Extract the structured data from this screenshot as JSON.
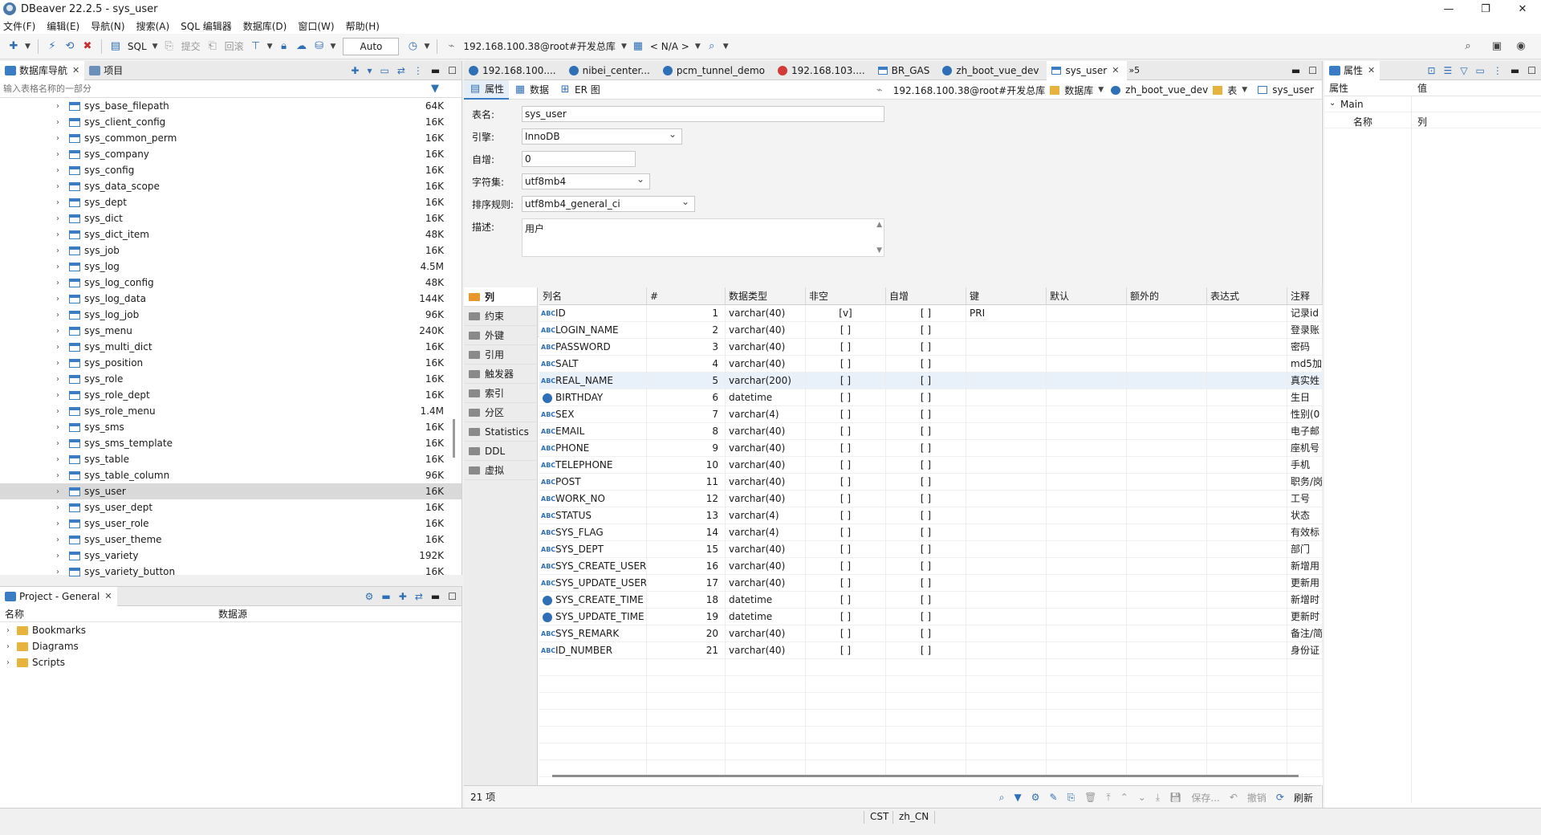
{
  "window": {
    "title": "DBeaver 22.2.5 - sys_user",
    "controls": [
      "—",
      "❐",
      "✕"
    ]
  },
  "menu": [
    "文件(F)",
    "编辑(E)",
    "导航(N)",
    "搜索(A)",
    "SQL 编辑器",
    "数据库(D)",
    "窗口(W)",
    "帮助(H)"
  ],
  "toolbar": {
    "sql_label": "SQL",
    "commit_label": "提交",
    "rollback_label": "回滚",
    "auto_label": "Auto",
    "connection": "192.168.100.38@root#开发总库",
    "schema": "N/A"
  },
  "navigator": {
    "tab_label": "数据库导航",
    "projects_tab_label": "项目",
    "filter_placeholder": "输入表格名称的一部分",
    "tables": [
      {
        "name": "sys_base_filepath",
        "size": "64K"
      },
      {
        "name": "sys_client_config",
        "size": "16K"
      },
      {
        "name": "sys_common_perm",
        "size": "16K"
      },
      {
        "name": "sys_company",
        "size": "16K"
      },
      {
        "name": "sys_config",
        "size": "16K"
      },
      {
        "name": "sys_data_scope",
        "size": "16K"
      },
      {
        "name": "sys_dept",
        "size": "16K"
      },
      {
        "name": "sys_dict",
        "size": "16K"
      },
      {
        "name": "sys_dict_item",
        "size": "48K"
      },
      {
        "name": "sys_job",
        "size": "16K"
      },
      {
        "name": "sys_log",
        "size": "4.5M"
      },
      {
        "name": "sys_log_config",
        "size": "48K"
      },
      {
        "name": "sys_log_data",
        "size": "144K"
      },
      {
        "name": "sys_log_job",
        "size": "96K"
      },
      {
        "name": "sys_menu",
        "size": "240K"
      },
      {
        "name": "sys_multi_dict",
        "size": "16K"
      },
      {
        "name": "sys_position",
        "size": "16K"
      },
      {
        "name": "sys_role",
        "size": "16K"
      },
      {
        "name": "sys_role_dept",
        "size": "16K"
      },
      {
        "name": "sys_role_menu",
        "size": "1.4M"
      },
      {
        "name": "sys_sms",
        "size": "16K"
      },
      {
        "name": "sys_sms_template",
        "size": "16K"
      },
      {
        "name": "sys_table",
        "size": "16K"
      },
      {
        "name": "sys_table_column",
        "size": "96K"
      },
      {
        "name": "sys_user",
        "size": "16K",
        "selected": true
      },
      {
        "name": "sys_user_dept",
        "size": "16K"
      },
      {
        "name": "sys_user_role",
        "size": "16K"
      },
      {
        "name": "sys_user_theme",
        "size": "16K"
      },
      {
        "name": "sys_variety",
        "size": "192K"
      },
      {
        "name": "sys_variety_button",
        "size": "16K"
      }
    ]
  },
  "project": {
    "tab_label": "Project - General",
    "col_name": "名称",
    "col_datasource": "数据源",
    "items": [
      "Bookmarks",
      "Diagrams",
      "Scripts"
    ]
  },
  "editor": {
    "tabs": [
      {
        "label": "192.168.100....",
        "icon": "db"
      },
      {
        "label": "nibei_center...",
        "icon": "db"
      },
      {
        "label": "pcm_tunnel_demo",
        "icon": "db"
      },
      {
        "label": "192.168.103....",
        "icon": "db-red"
      },
      {
        "label": "BR_GAS",
        "icon": "table"
      },
      {
        "label": "zh_boot_vue_dev",
        "icon": "db"
      },
      {
        "label": "sys_user",
        "icon": "table",
        "active": true
      }
    ],
    "overflow_label": "»5",
    "subtabs": [
      "属性",
      "数据",
      "ER 图"
    ],
    "crumbs": {
      "connection": "192.168.100.38@root#开发总库",
      "db_label": "数据库",
      "database": "zh_boot_vue_dev",
      "table_label": "表",
      "table": "sys_user"
    },
    "form": {
      "table_name_label": "表名:",
      "table_name": "sys_user",
      "engine_label": "引擎:",
      "engine": "InnoDB",
      "auto_inc_label": "自增:",
      "auto_inc": "0",
      "charset_label": "字符集:",
      "charset": "utf8mb4",
      "collation_label": "排序规则:",
      "collation": "utf8mb4_general_ci",
      "desc_label": "描述:",
      "desc": "用户"
    },
    "side_tabs": [
      "列",
      "约束",
      "外键",
      "引用",
      "触发器",
      "索引",
      "分区",
      "Statistics",
      "DDL",
      "虚拟"
    ],
    "grid": {
      "headers": [
        "列名",
        "#",
        "数据类型",
        "非空",
        "自增",
        "键",
        "默认",
        "额外的",
        "表达式",
        "注释"
      ],
      "rows": [
        {
          "name": "ID",
          "num": "1",
          "type": "varchar(40)",
          "notnull": "[v]",
          "autoinc": "[ ]",
          "key": "PRI",
          "comment": "记录id",
          "icon": "abc"
        },
        {
          "name": "LOGIN_NAME",
          "num": "2",
          "type": "varchar(40)",
          "notnull": "[ ]",
          "autoinc": "[ ]",
          "key": "",
          "comment": "登录账",
          "icon": "abc"
        },
        {
          "name": "PASSWORD",
          "num": "3",
          "type": "varchar(40)",
          "notnull": "[ ]",
          "autoinc": "[ ]",
          "key": "",
          "comment": "密码",
          "icon": "abc"
        },
        {
          "name": "SALT",
          "num": "4",
          "type": "varchar(40)",
          "notnull": "[ ]",
          "autoinc": "[ ]",
          "key": "",
          "comment": "md5加",
          "icon": "abc"
        },
        {
          "name": "REAL_NAME",
          "num": "5",
          "type": "varchar(200)",
          "notnull": "[ ]",
          "autoinc": "[ ]",
          "key": "",
          "comment": "真实姓",
          "icon": "abc",
          "highlight": true
        },
        {
          "name": "BIRTHDAY",
          "num": "6",
          "type": "datetime",
          "notnull": "[ ]",
          "autoinc": "[ ]",
          "key": "",
          "comment": "生日",
          "icon": "clock"
        },
        {
          "name": "SEX",
          "num": "7",
          "type": "varchar(4)",
          "notnull": "[ ]",
          "autoinc": "[ ]",
          "key": "",
          "comment": "性别(0",
          "icon": "abc"
        },
        {
          "name": "EMAIL",
          "num": "8",
          "type": "varchar(40)",
          "notnull": "[ ]",
          "autoinc": "[ ]",
          "key": "",
          "comment": "电子邮",
          "icon": "abc"
        },
        {
          "name": "PHONE",
          "num": "9",
          "type": "varchar(40)",
          "notnull": "[ ]",
          "autoinc": "[ ]",
          "key": "",
          "comment": "座机号",
          "icon": "abc"
        },
        {
          "name": "TELEPHONE",
          "num": "10",
          "type": "varchar(40)",
          "notnull": "[ ]",
          "autoinc": "[ ]",
          "key": "",
          "comment": "手机",
          "icon": "abc"
        },
        {
          "name": "POST",
          "num": "11",
          "type": "varchar(40)",
          "notnull": "[ ]",
          "autoinc": "[ ]",
          "key": "",
          "comment": "职务/岗",
          "icon": "abc"
        },
        {
          "name": "WORK_NO",
          "num": "12",
          "type": "varchar(40)",
          "notnull": "[ ]",
          "autoinc": "[ ]",
          "key": "",
          "comment": "工号",
          "icon": "abc"
        },
        {
          "name": "STATUS",
          "num": "13",
          "type": "varchar(4)",
          "notnull": "[ ]",
          "autoinc": "[ ]",
          "key": "",
          "comment": "状态",
          "icon": "abc"
        },
        {
          "name": "SYS_FLAG",
          "num": "14",
          "type": "varchar(4)",
          "notnull": "[ ]",
          "autoinc": "[ ]",
          "key": "",
          "comment": "有效标",
          "icon": "abc"
        },
        {
          "name": "SYS_DEPT",
          "num": "15",
          "type": "varchar(40)",
          "notnull": "[ ]",
          "autoinc": "[ ]",
          "key": "",
          "comment": "部门",
          "icon": "abc"
        },
        {
          "name": "SYS_CREATE_USER",
          "num": "16",
          "type": "varchar(40)",
          "notnull": "[ ]",
          "autoinc": "[ ]",
          "key": "",
          "comment": "新增用",
          "icon": "abc"
        },
        {
          "name": "SYS_UPDATE_USER",
          "num": "17",
          "type": "varchar(40)",
          "notnull": "[ ]",
          "autoinc": "[ ]",
          "key": "",
          "comment": "更新用",
          "icon": "abc"
        },
        {
          "name": "SYS_CREATE_TIME",
          "num": "18",
          "type": "datetime",
          "notnull": "[ ]",
          "autoinc": "[ ]",
          "key": "",
          "comment": "新增时",
          "icon": "clock"
        },
        {
          "name": "SYS_UPDATE_TIME",
          "num": "19",
          "type": "datetime",
          "notnull": "[ ]",
          "autoinc": "[ ]",
          "key": "",
          "comment": "更新时",
          "icon": "clock"
        },
        {
          "name": "SYS_REMARK",
          "num": "20",
          "type": "varchar(40)",
          "notnull": "[ ]",
          "autoinc": "[ ]",
          "key": "",
          "comment": "备注/简",
          "icon": "abc"
        },
        {
          "name": "ID_NUMBER",
          "num": "21",
          "type": "varchar(40)",
          "notnull": "[ ]",
          "autoinc": "[ ]",
          "key": "",
          "comment": "身份证",
          "icon": "abc"
        }
      ]
    },
    "status": {
      "count": "21 项",
      "save_label": "保存...",
      "cancel_label": "撤销",
      "refresh_label": "刷新"
    }
  },
  "properties": {
    "tab_label": "属性",
    "col_prop": "属性",
    "col_value": "值",
    "group": "Main",
    "row_name": "名称",
    "row_value": "列"
  },
  "statusbar": {
    "timezone": "CST",
    "locale": "zh_CN"
  }
}
